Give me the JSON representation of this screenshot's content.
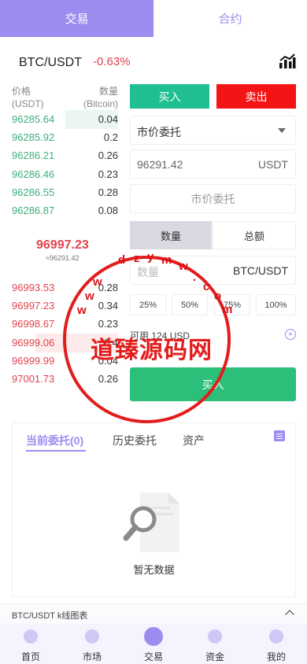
{
  "tabs": {
    "trade": "交易",
    "contract": "合约"
  },
  "pair": "BTC/USDT",
  "change": "-0.63%",
  "orderbook": {
    "price_label": "价格",
    "price_unit": "(USDT)",
    "qty_label": "数量",
    "qty_unit": "(Bitcoin)",
    "buy": [
      {
        "price": "96285.64",
        "qty": "0.04",
        "depth": 0.45
      },
      {
        "price": "96285.92",
        "qty": "0.2",
        "depth": 0
      },
      {
        "price": "96286.21",
        "qty": "0.26",
        "depth": 0
      },
      {
        "price": "96286.46",
        "qty": "0.23",
        "depth": 0
      },
      {
        "price": "96286.55",
        "qty": "0.28",
        "depth": 0
      },
      {
        "price": "96286.87",
        "qty": "0.08",
        "depth": 0
      }
    ],
    "last_price": "96997.23",
    "last_sub": "≈96291.42",
    "sell": [
      {
        "price": "96993.53",
        "qty": "0.28",
        "depth": 0
      },
      {
        "price": "96997.23",
        "qty": "0.34",
        "depth": 0
      },
      {
        "price": "96998.67",
        "qty": "0.23",
        "depth": 0
      },
      {
        "price": "96999.06",
        "qty": "0.4",
        "depth": 0.7
      },
      {
        "price": "96999.99",
        "qty": "0.04",
        "depth": 0
      },
      {
        "price": "97001.73",
        "qty": "0.26",
        "depth": 0
      }
    ]
  },
  "form": {
    "buy": "买入",
    "sell": "卖出",
    "order_type": "市价委托",
    "price_value": "96291.42",
    "price_unit": "USDT",
    "market_btn": "市价委托",
    "tab_qty": "数量",
    "tab_total": "总额",
    "qty_placeholder": "数量",
    "qty_unit": "BTC/USDT",
    "p25": "25%",
    "p50": "50%",
    "p75": "75%",
    "p100": "100%",
    "available": "可用 124 USD",
    "submit": "买入"
  },
  "orders": {
    "tab_current": "当前委托(0)",
    "tab_history": "历史委托",
    "tab_assets": "资产",
    "empty": "暂无数据"
  },
  "kline_bar": "BTC/USDT k线图表",
  "nav": [
    "首页",
    "市场",
    "交易",
    "资金",
    "我的"
  ],
  "watermark": {
    "text": "道臻源码网",
    "letters": [
      "d",
      "z",
      "y",
      "m",
      "w",
      ".",
      "c",
      "o",
      "m",
      "w",
      "w",
      "w"
    ]
  }
}
